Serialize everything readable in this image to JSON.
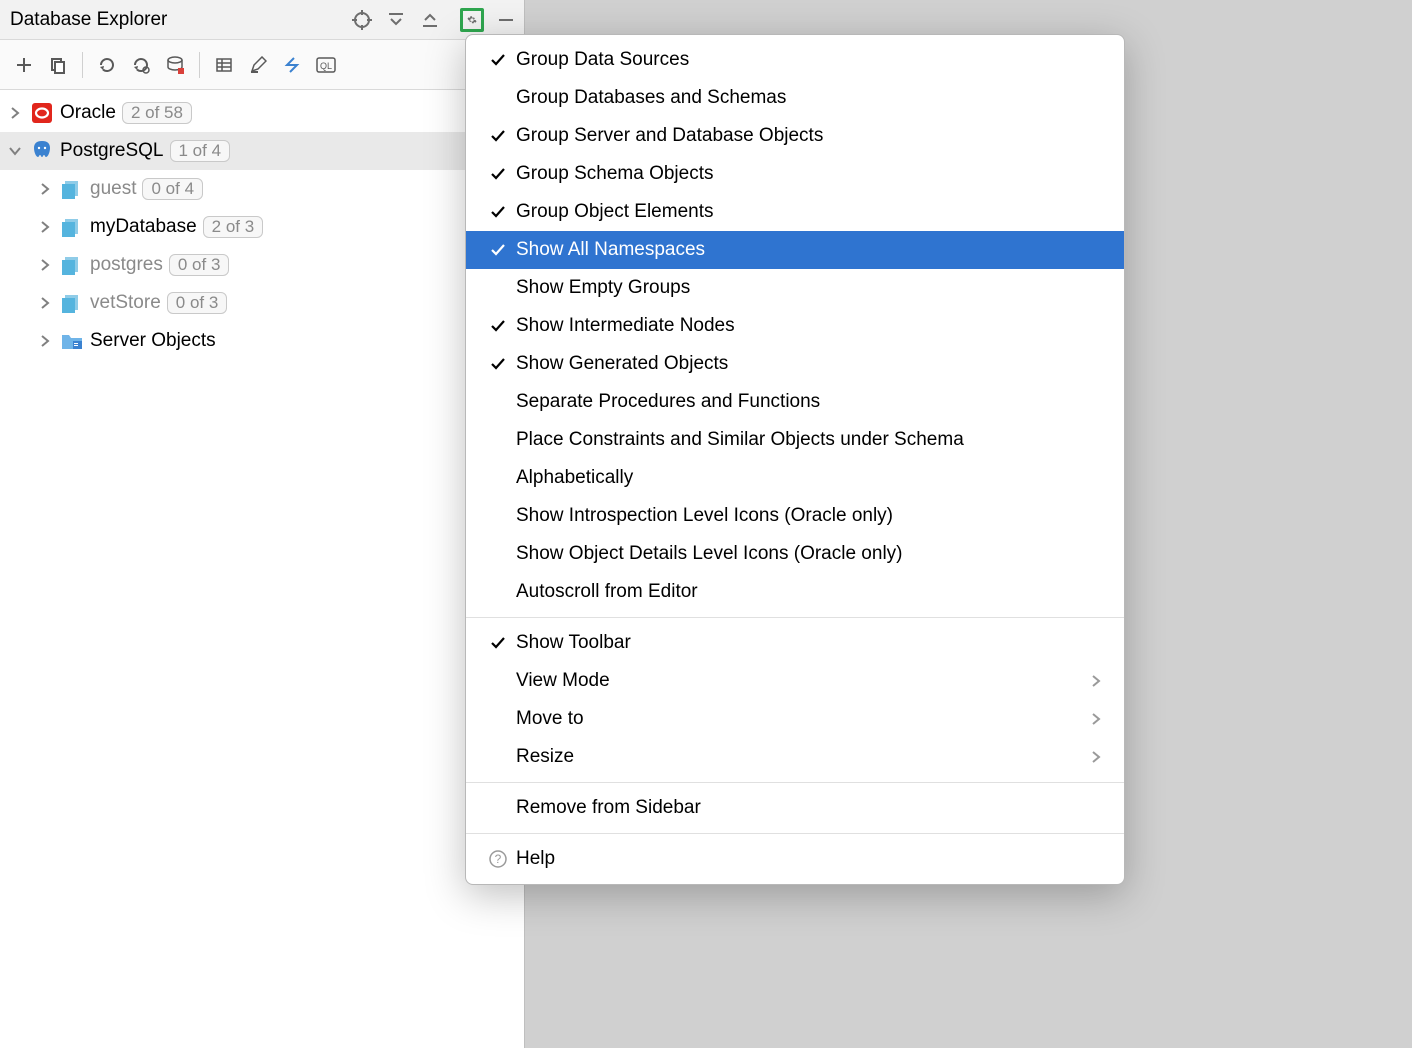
{
  "panel": {
    "title": "Database Explorer"
  },
  "tree": {
    "oracle": {
      "label": "Oracle",
      "badge": "2 of 58"
    },
    "postgres": {
      "label": "PostgreSQL",
      "badge": "1 of 4"
    },
    "children": [
      {
        "label": "guest",
        "badge": "0 of 4",
        "muted": true
      },
      {
        "label": "myDatabase",
        "badge": "2 of 3",
        "muted": false
      },
      {
        "label": "postgres",
        "badge": "0 of 3",
        "muted": true
      },
      {
        "label": "vetStore",
        "badge": "0 of 3",
        "muted": true
      }
    ],
    "serverObjects": {
      "label": "Server Objects"
    }
  },
  "menu": {
    "group1": [
      {
        "label": "Group Data Sources",
        "checked": true
      },
      {
        "label": "Group Databases and Schemas",
        "checked": false
      },
      {
        "label": "Group Server and Database Objects",
        "checked": true
      },
      {
        "label": "Group Schema Objects",
        "checked": true
      },
      {
        "label": "Group Object Elements",
        "checked": true
      },
      {
        "label": "Show All Namespaces",
        "checked": true,
        "selected": true
      },
      {
        "label": "Show Empty Groups",
        "checked": false
      },
      {
        "label": "Show Intermediate Nodes",
        "checked": true
      },
      {
        "label": "Show Generated Objects",
        "checked": true
      },
      {
        "label": "Separate Procedures and Functions",
        "checked": false
      },
      {
        "label": "Place Constraints and Similar Objects under Schema",
        "checked": false
      },
      {
        "label": "Alphabetically",
        "checked": false
      },
      {
        "label": "Show Introspection Level Icons (Oracle only)",
        "checked": false
      },
      {
        "label": "Show Object Details Level Icons (Oracle only)",
        "checked": false
      },
      {
        "label": "Autoscroll from Editor",
        "checked": false
      }
    ],
    "group2": [
      {
        "label": "Show Toolbar",
        "checked": true
      },
      {
        "label": "View Mode",
        "submenu": true
      },
      {
        "label": "Move to",
        "submenu": true
      },
      {
        "label": "Resize",
        "submenu": true
      }
    ],
    "group3": [
      {
        "label": "Remove from Sidebar"
      }
    ],
    "help": {
      "label": "Help"
    }
  }
}
